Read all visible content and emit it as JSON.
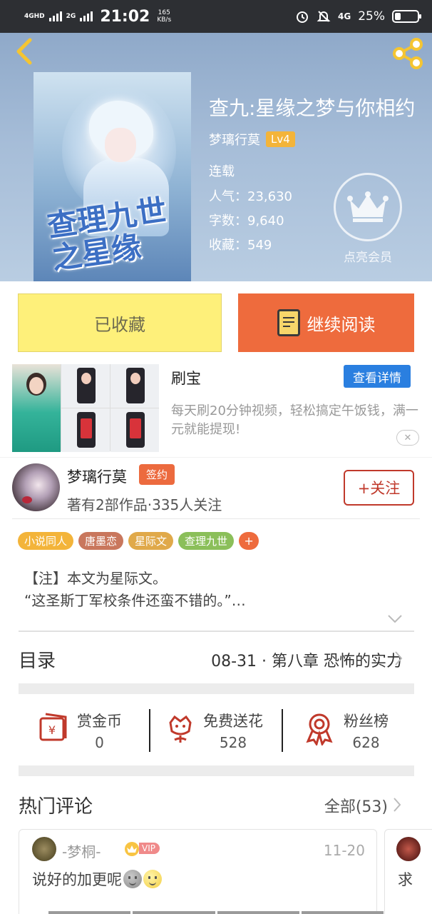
{
  "status_bar": {
    "net_left": "4GHD",
    "net_right": "2G",
    "time": "21:02",
    "speed_value": "165",
    "speed_unit": "KB/s",
    "net_4g": "4G",
    "battery": "25%",
    "battery_level": 0.25
  },
  "book": {
    "cover_title": "查理九世之星缘",
    "title": "查九:星缘之梦与你相约",
    "author": "梦璃行莫",
    "level": "Lv4",
    "status": "连载",
    "popularity_label": "人气：",
    "popularity": "23,630",
    "words_label": "字数：",
    "words": "9,640",
    "favorites_label": "收藏：",
    "favorites": "549",
    "member_label": "点亮会员"
  },
  "actions": {
    "collected": "已收藏",
    "continue_reading": "继续阅读"
  },
  "ad": {
    "title": "刷宝",
    "detail_button": "查看详情",
    "description": "每天刷20分钟视频，轻松搞定午饭钱，满一元就能提现!",
    "close": "✕"
  },
  "author_info": {
    "name": "梦璃行莫",
    "badge": "签约",
    "meta": "著有2部作品·335人关注",
    "follow": "+关注"
  },
  "tags": [
    {
      "label": "小说同人",
      "color": "#f3b43a"
    },
    {
      "label": "唐墨恋",
      "color": "#c9775d"
    },
    {
      "label": "星际文",
      "color": "#e0a94a"
    },
    {
      "label": "查理九世",
      "color": "#8bbf5a"
    },
    {
      "label": "+",
      "color": "#ee6b3d"
    }
  ],
  "synopsis": {
    "line1": "【注】本文为星际文。",
    "line2": "“这圣斯丁军校条件还蛮不错的。”…"
  },
  "catalog": {
    "label": "目录",
    "latest": "08-31 · 第八章  恐怖的实力"
  },
  "rewards": [
    {
      "label": "赏金币",
      "value": "0",
      "icon": "gold-coin-icon"
    },
    {
      "label": "免费送花",
      "value": "528",
      "icon": "flower-icon"
    },
    {
      "label": "粉丝榜",
      "value": "628",
      "icon": "award-ribbon-icon"
    }
  ],
  "comments": {
    "label": "热门评论",
    "all_label": "全部(53)",
    "items": [
      {
        "user": "-梦桐-",
        "vip": "VIP",
        "date": "11-20",
        "text": "说好的加更呢"
      },
      {
        "text": "求"
      }
    ]
  },
  "colors": {
    "accent_orange": "#ee6b3d",
    "collected_yellow": "#fef07a",
    "follow_red": "#c0392b",
    "detail_blue": "#2a7fe0"
  }
}
